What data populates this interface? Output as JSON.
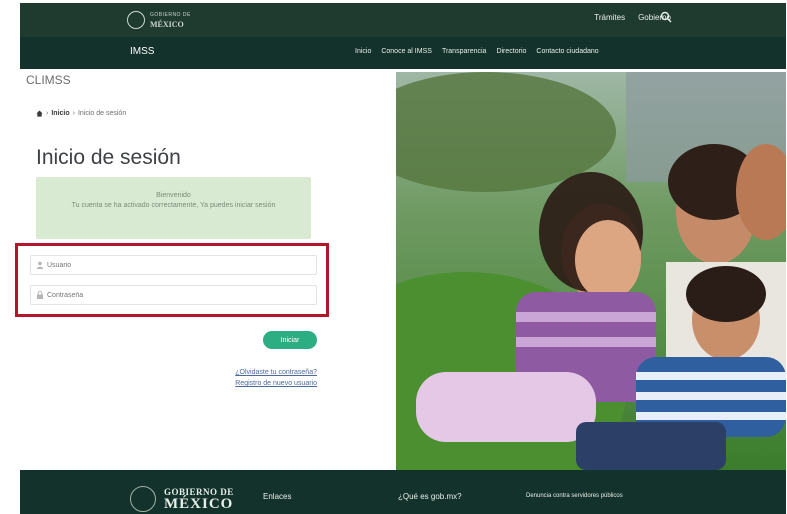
{
  "header": {
    "logo_small_top": "GOBIERNO DE",
    "logo_small_bottom": "MÉXICO",
    "links": [
      "Trámites",
      "Gobierno"
    ],
    "brand": "IMSS",
    "nav": [
      "Inicio",
      "Conoce al IMSS",
      "Transparencia",
      "Directorio",
      "Contacto ciudadano"
    ]
  },
  "page": {
    "site_name": "CLIMSS",
    "breadcrumb": {
      "home": "Inicio",
      "current": "Inicio de sesión",
      "separator": "›"
    },
    "title": "Inicio de sesión"
  },
  "alert": {
    "line1": "Bienvenido",
    "line2": "Tu cuenta se ha activado correctamente, Ya puedes iniciar sesión"
  },
  "form": {
    "username_placeholder": "Usuario",
    "password_placeholder": "Contraseña",
    "submit_label": "Iniciar"
  },
  "links": {
    "forgot": "¿Olvidaste tu contraseña?",
    "register": "Registro de nuevo usuario"
  },
  "footer": {
    "logo_top": "GOBIERNO DE",
    "logo_bottom": "MÉXICO",
    "col1": "Enlaces",
    "col2": "¿Qué es gob.mx?",
    "col3": "Denuncia contra servidores públicos"
  },
  "colors": {
    "header_bg": "#1f3a2e",
    "nav_bg": "#13322b",
    "alert_bg": "#d9ead3",
    "button": "#2dae82",
    "highlight": "#b2162a"
  },
  "icons": [
    "search-icon",
    "home-icon",
    "user-icon",
    "lock-icon",
    "seal-icon"
  ]
}
